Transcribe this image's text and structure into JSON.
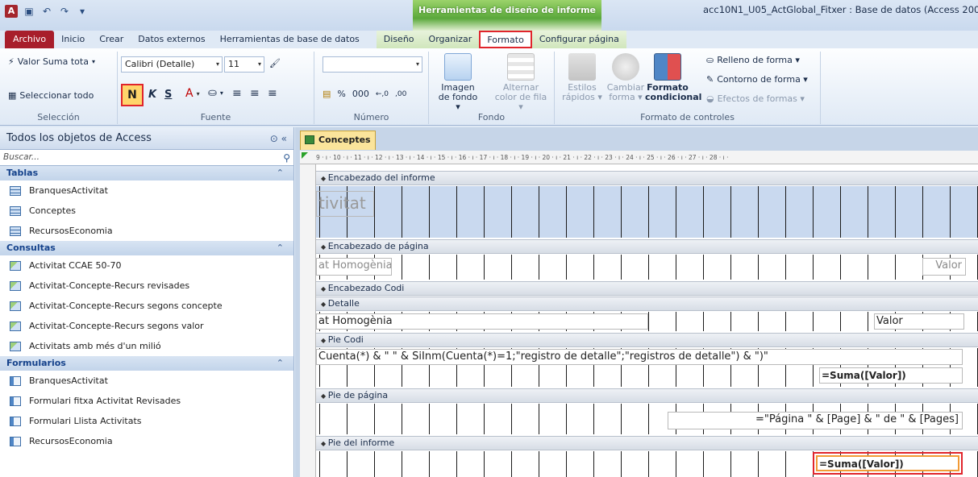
{
  "title_bar": {
    "contextual_title": "Herramientas de diseño de informe",
    "window_title": "acc10N1_U05_ActGlobal_Fitxer : Base de datos (Access 200"
  },
  "tabs": [
    "Archivo",
    "Inicio",
    "Crear",
    "Datos externos",
    "Herramientas de base de datos",
    "Diseño",
    "Organizar",
    "Formato",
    "Configurar página"
  ],
  "ribbon": {
    "seleccion": {
      "combo": "Valor Suma tota",
      "select_all": "Seleccionar todo",
      "label": "Selección"
    },
    "fuente": {
      "font": "Calibri (Detalle)",
      "size": "11",
      "bold": "N",
      "italic": "K",
      "underline": "S",
      "label": "Fuente"
    },
    "numero": {
      "percent": "%",
      "thousands": "000",
      "inc_dec": "←,0",
      "dec_dec": ",00",
      "label": "Número"
    },
    "fondo": {
      "image": "Imagen de fondo ▾",
      "alt_color": "Alternar color de fila ▾",
      "label": "Fondo"
    },
    "formato_controles": {
      "styles": "Estilos rápidos ▾",
      "change_shape": "Cambiar forma ▾",
      "conditional": "Formato condicional",
      "fill": "Relleno de forma ▾",
      "outline": "Contorno de forma ▾",
      "effects": "Efectos de formas ▾",
      "label": "Formato de controles"
    }
  },
  "nav": {
    "header": "Todos los objetos de Access",
    "search_placeholder": "Buscar...",
    "groups": [
      {
        "name": "Tablas",
        "items": [
          "BranquesActivitat",
          "Conceptes",
          "RecursosEconomia"
        ]
      },
      {
        "name": "Consultas",
        "items": [
          "Activitat CCAE 50-70",
          "Activitat-Concepte-Recurs revisades",
          "Activitat-Concepte-Recurs segons concepte",
          "Activitat-Concepte-Recurs segons valor",
          "Activitats amb més d'un milió"
        ]
      },
      {
        "name": "Formularios",
        "items": [
          "BranquesActivitat",
          "Formulari fitxa Activitat Revisades",
          "Formulari Llista Activitats",
          "RecursosEconomia"
        ]
      }
    ]
  },
  "designer": {
    "doc_tab": "Conceptes",
    "ruler": "9 · ı · 10 · ı · 11 · ı · 12 · ı · 13 · ı · 14 · ı · 15 · ı · 16 · ı · 17 · ı · 18 · ı · 19 · ı · 20 · ı · 21 · ı · 22 · ı · 23 · ı · 24 · ı · 25 · ı · 26 · ı · 27 · ı · 28 · ı ·",
    "sections": {
      "report_header": "Encabezado del informe",
      "page_header": "Encabezado de página",
      "group_header": "Encabezado Codi",
      "detail": "Detalle",
      "group_footer": "Pie Codi",
      "page_footer": "Pie de página",
      "report_footer": "Pie del informe"
    },
    "controls": {
      "report_title": "tivitat",
      "page_header_label": "at Homogènia",
      "page_header_valor": "Valor",
      "detail_field": "at Homogènia",
      "detail_valor": "Valor",
      "count_expr": "Cuenta(*) & \" \" & SiInm(Cuenta(*)=1;\"registro de detalle\";\"registros de detalle\") & \")\"",
      "group_sum": "=Suma([Valor])",
      "page_expr": "=\"Página \" & [Page] & \" de \" & [Pages]",
      "report_sum": "=Suma([Valor])"
    }
  }
}
